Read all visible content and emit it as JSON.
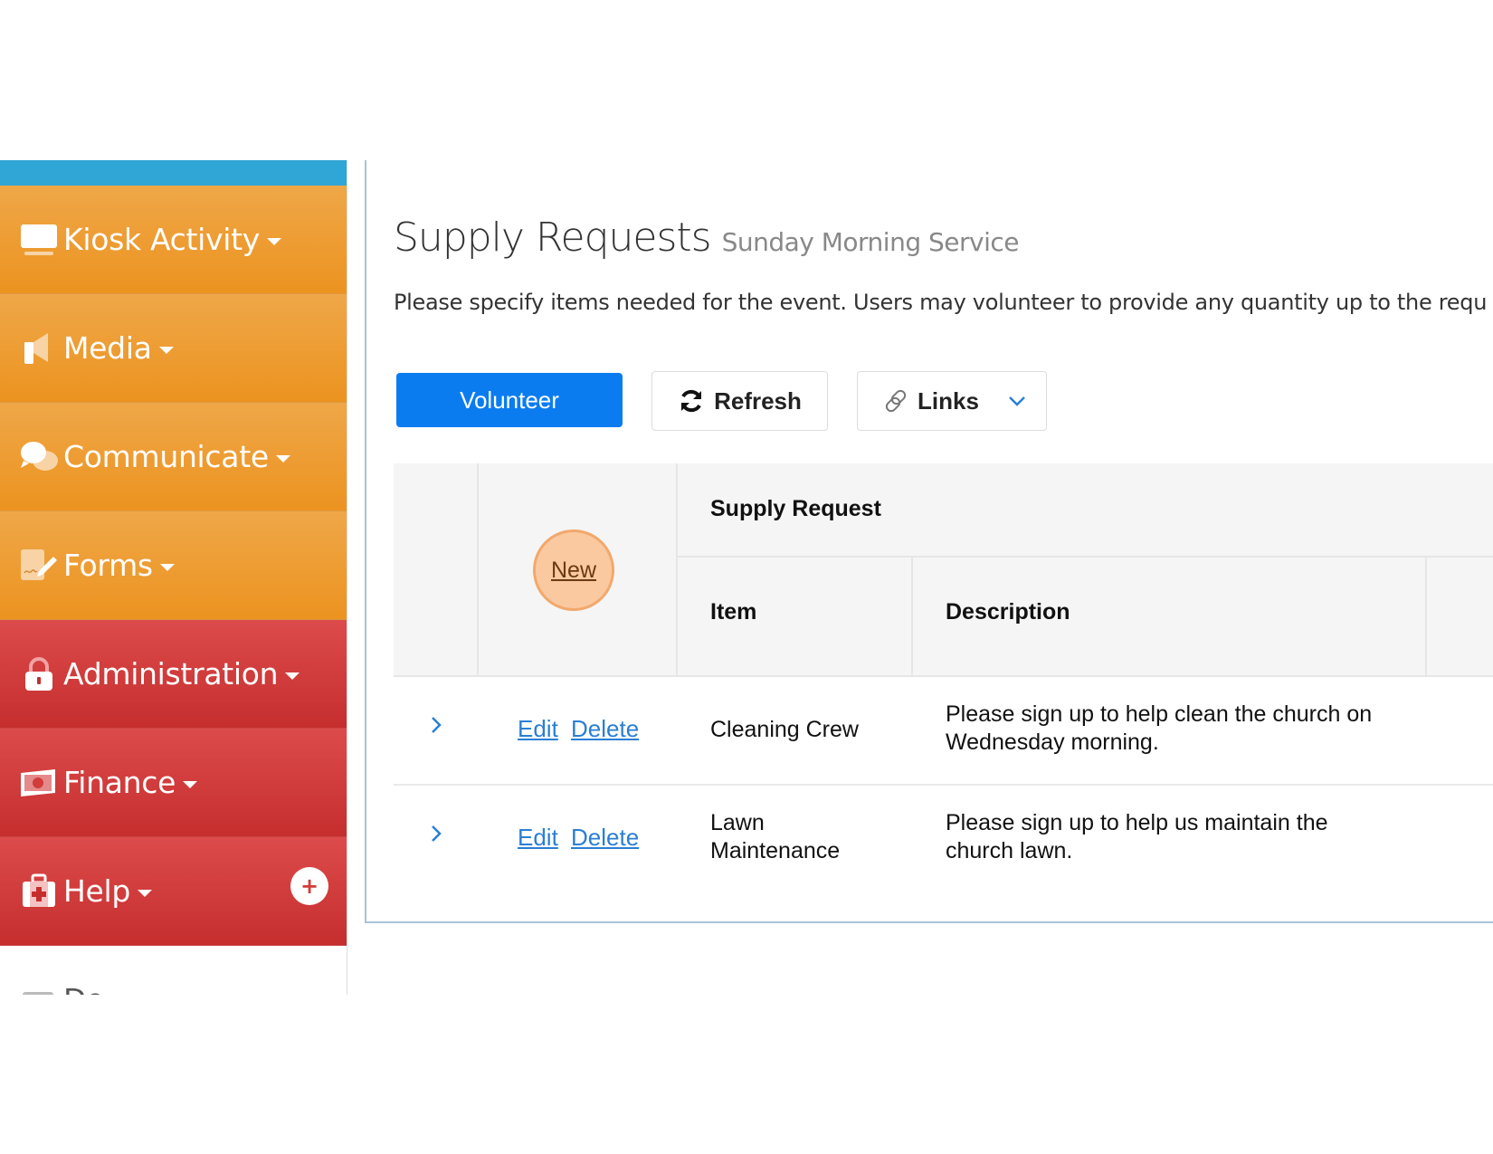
{
  "sidebar": {
    "items": [
      {
        "label": "Kiosk Activity",
        "icon": "monitor-icon",
        "color": "orange"
      },
      {
        "label": "Media",
        "icon": "megaphone-icon",
        "color": "orange"
      },
      {
        "label": "Communicate",
        "icon": "chat-bubbles-icon",
        "color": "orange"
      },
      {
        "label": "Forms",
        "icon": "form-signature-icon",
        "color": "orange"
      },
      {
        "label": "Administration",
        "icon": "lock-icon",
        "color": "red"
      },
      {
        "label": "Finance",
        "icon": "money-icon",
        "color": "red"
      },
      {
        "label": "Help",
        "icon": "first-aid-kit-icon",
        "color": "red",
        "badge": "+"
      },
      {
        "label": "Do...",
        "icon": "document-icon",
        "color": "white"
      }
    ],
    "colors": {
      "topbar": "#2fa6d6",
      "orange": "#ec9320",
      "red": "#c62e2e"
    }
  },
  "header": {
    "title": "Supply Requests",
    "subtitle": "Sunday Morning Service",
    "intro": "Please specify items needed for the event. Users may volunteer to provide any quantity up to the requ"
  },
  "toolbar": {
    "volunteer_label": "Volunteer",
    "refresh_label": "Refresh",
    "links_label": "Links",
    "accent": "#0b7cf0"
  },
  "table": {
    "new_label": "New",
    "group_header": "Supply Request",
    "columns": [
      "Item",
      "Description"
    ],
    "edit_label": "Edit",
    "delete_label": "Delete",
    "rows": [
      {
        "item": "Cleaning Crew",
        "description": "Please sign up to help clean the church on Wednesday morning."
      },
      {
        "item": "Lawn Maintenance",
        "description": "Please sign up to help us maintain the church lawn."
      }
    ]
  }
}
